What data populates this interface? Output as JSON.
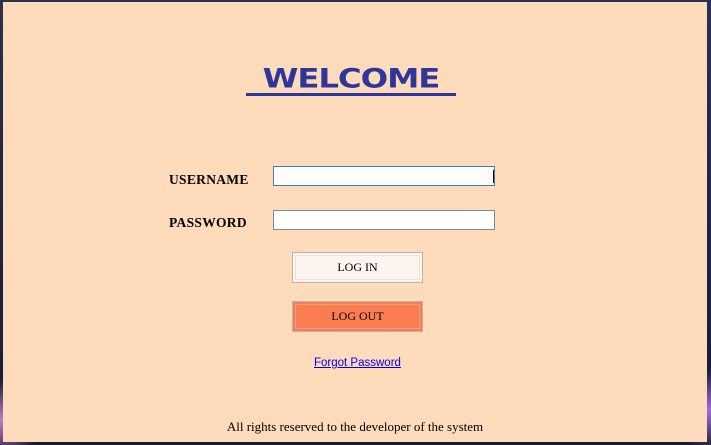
{
  "header": {
    "title": "WELCOME"
  },
  "form": {
    "username_label": "USERNAME",
    "username_value": "",
    "password_label": "PASSWORD",
    "password_value": ""
  },
  "buttons": {
    "login_label": "LOG IN",
    "logout_label": "LOG OUT"
  },
  "links": {
    "forgot_password": "Forgot Password"
  },
  "footer": {
    "text": "All rights reserved to the developer of the system"
  },
  "colors": {
    "background": "#fddbbb",
    "title": "#2e3799",
    "logout_button": "#f97d50",
    "login_button": "#fdf3ef",
    "link": "#0000ee"
  }
}
